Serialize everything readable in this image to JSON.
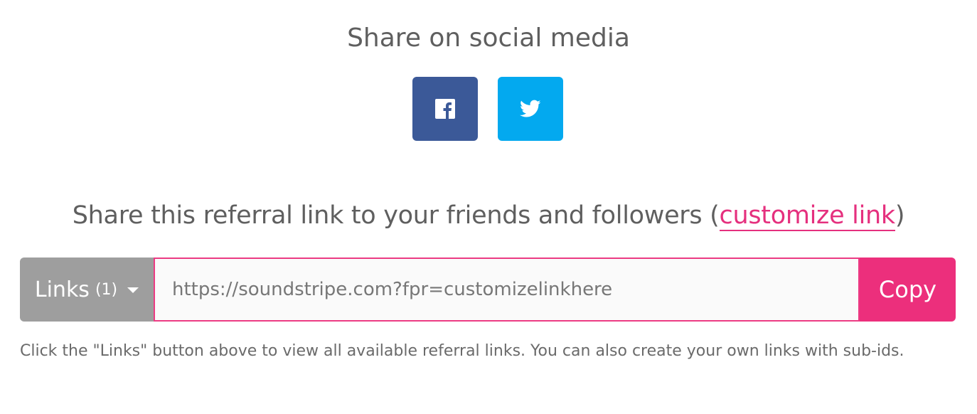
{
  "social": {
    "title": "Share on social media",
    "buttons": [
      {
        "name": "facebook",
        "color": "#3b5998",
        "icon": "facebook-icon"
      },
      {
        "name": "twitter",
        "color": "#03a9ef",
        "icon": "twitter-icon"
      }
    ]
  },
  "referral": {
    "title_prefix": "Share this referral link to your friends and followers (",
    "customize_label": "customize link",
    "title_suffix": ")",
    "link_color": "#e5307e"
  },
  "link_bar": {
    "links_label": "Links",
    "links_count": "(1)",
    "url_value": "https://soundstripe.com?fpr=customizelinkhere",
    "copy_label": "Copy",
    "links_bg": "#9e9e9e",
    "copy_bg": "#ec2f7c"
  },
  "help_text": "Click the \"Links\" button above to view all available referral links. You can also create your own links with sub-ids."
}
